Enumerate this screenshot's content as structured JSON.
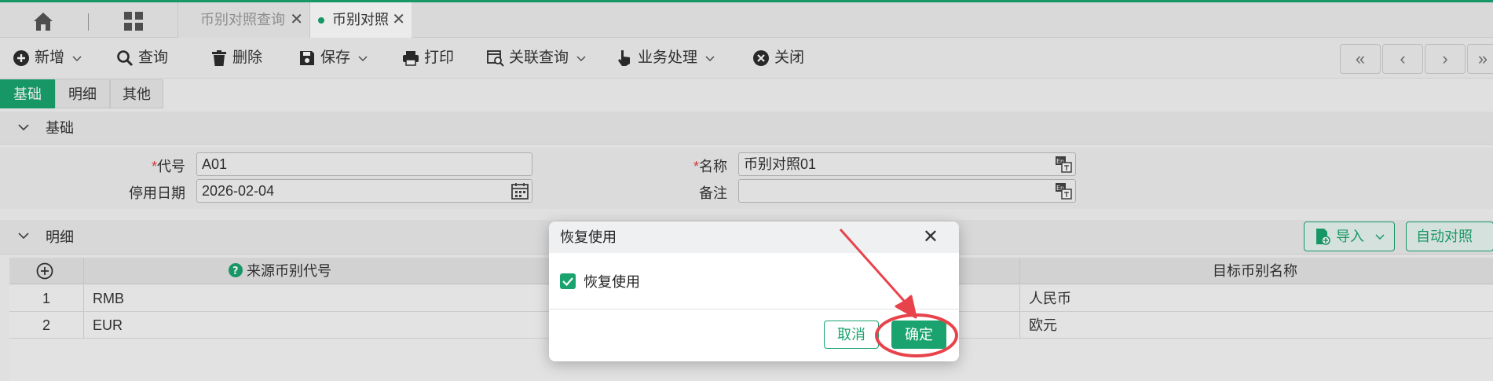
{
  "tabs": {
    "home_icon": "home-icon",
    "grid_icon": "apps-grid-icon",
    "items": [
      {
        "label": "币别对照查询"
      },
      {
        "label": "币别对照"
      }
    ],
    "close_glyph": "✕"
  },
  "toolbar": {
    "new_label": "新增",
    "query_label": "查询",
    "delete_label": "删除",
    "save_label": "保存",
    "print_label": "打印",
    "related_query_label": "关联查询",
    "business_label": "业务处理",
    "close_label": "关闭",
    "nav": [
      "«",
      "‹",
      "›",
      "»"
    ]
  },
  "subtabs": {
    "items": [
      {
        "label": "基础"
      },
      {
        "label": "明细"
      },
      {
        "label": "其他"
      }
    ]
  },
  "basic": {
    "section_title": "基础",
    "code_label": "代号",
    "code_value": "A01",
    "name_label": "名称",
    "name_value": "币别对照01",
    "stop_date_label": "停用日期",
    "stop_date_value": "2026-02-04",
    "remark_label": "备注",
    "remark_value": "",
    "required_mark": "*"
  },
  "detail": {
    "section_title": "明细",
    "import_label": "导入",
    "auto_match_label": "自动对照",
    "columns": {
      "source_code": "来源币别代号",
      "target_name": "目标币别名称"
    },
    "rows": [
      {
        "no": "1",
        "source_code": "RMB",
        "target_name": "人民币"
      },
      {
        "no": "2",
        "source_code": "EUR",
        "target_name": "欧元"
      }
    ]
  },
  "dialog": {
    "title": "恢复使用",
    "checkbox_label": "恢复使用",
    "checkbox_checked": true,
    "cancel_label": "取消",
    "ok_label": "确定"
  },
  "colors": {
    "accent": "#1aa36f",
    "annotation": "#e8434b"
  }
}
